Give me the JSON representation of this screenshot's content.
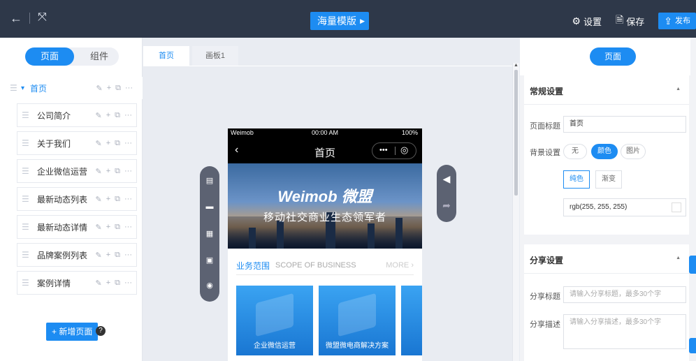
{
  "topbar": {
    "back_icon": "←",
    "fullscreen_icon": "⤧",
    "template_label": "海量模版",
    "settings_label": "设置",
    "save_label": "保存",
    "publish_label": "发布"
  },
  "left": {
    "seg_pages": "页面",
    "seg_components": "组件",
    "root_page": "首页",
    "pages": [
      "公司简介",
      "关于我们",
      "企业微信运营",
      "最新动态列表",
      "最新动态详情",
      "品牌案例列表",
      "案例详情"
    ],
    "add_page": "+ 新增页面",
    "help": "?"
  },
  "canvas": {
    "tabs": [
      "首页",
      "画板1"
    ],
    "phone": {
      "status_left": "Weimob",
      "status_time": "00:00 AM",
      "status_right": "100%",
      "nav_title": "首页",
      "banner_brand": "Weimob 微盟",
      "banner_slogan": "移动社交商业生态领军者",
      "section_cn": "业务范围",
      "section_en": "SCOPE OF BUSINESS",
      "section_more": "MORE",
      "cards": [
        "企业微信运营",
        "微盟微电商解决方案",
        ""
      ]
    }
  },
  "right": {
    "head_pill": "页面",
    "general": {
      "title": "常规设置",
      "page_title_label": "页面标题",
      "page_title_value": "首页",
      "bg_label": "背景设置",
      "bg_options": [
        "无",
        "颜色",
        "图片"
      ],
      "bg_types": [
        "纯色",
        "渐变"
      ],
      "color_value": "rgb(255, 255, 255)"
    },
    "share": {
      "title": "分享设置",
      "share_title_label": "分享标题",
      "share_title_placeholder": "请输入分享标题，最多30个字",
      "share_desc_label": "分享描述",
      "share_desc_placeholder": "请输入分享描述，最多30个字"
    }
  },
  "colors": {
    "accent": "#1d8cf2",
    "topbar": "#2e3849"
  }
}
